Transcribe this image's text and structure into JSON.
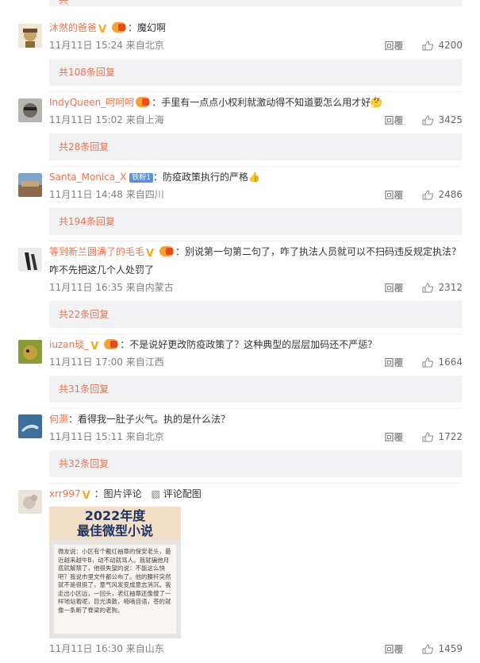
{
  "comments": [
    {
      "user": "沐然的爸爸",
      "text": "：魔幻啊",
      "time": "11月11日 15:24 来自北京",
      "reply": "回覆",
      "likes": "4200",
      "replies": "共108条回复",
      "avatar_color": "#c8a26b"
    },
    {
      "user": "IndyQueen_呵呵呵",
      "text": "：手里有一点点小权利就激动得不知道要怎么用才好",
      "time": "11月11日 15:02 来自上海",
      "reply": "回覆",
      "likes": "3425",
      "replies": "共28条回复",
      "avatar_color": "#6d6a66"
    },
    {
      "user": "Santa_Monica_X",
      "badge": "铁粉1",
      "text": "：防疫政策执行的严格",
      "time": "11月11日 14:48 来自四川",
      "reply": "回覆",
      "likes": "2486",
      "replies": "共194条回复",
      "avatar_color": "#8a6a4a"
    },
    {
      "user": "等到新兰圆满了的毛毛",
      "text": "：别说第一句第二句了，咋了执法人员就可以不扫码违反规定执法？",
      "text2": "咋不先把这几个人处罚了",
      "time": "11月11日 16:35 来自内蒙古",
      "reply": "回覆",
      "likes": "2312",
      "replies": "共22条回复",
      "avatar_color": "#d9d9d9"
    },
    {
      "user": "iuzan琰_",
      "text": "：不是说好更改防疫政策了？这种典型的层层加码还不严惩？",
      "time": "11月11日 17:00 来自江西",
      "reply": "回覆",
      "likes": "1664",
      "replies": "共31条回复",
      "avatar_color": "#7a8a3a"
    },
    {
      "user": "何灏",
      "text": "：看得我一肚子火气。执的是什么法？",
      "time": "11月11日 15:11 来自北京",
      "reply": "回覆",
      "likes": "1722",
      "replies": "共32条回复",
      "avatar_color": "#5a8bb0"
    },
    {
      "user": "xrr997",
      "text": "：图片评论",
      "pic_link": "评论配图",
      "time": "11月11日 16:30 来自山东",
      "reply": "回覆",
      "likes": "1459",
      "avatar_color": "#cfc6bb"
    }
  ],
  "top_replies_partial": "共",
  "image_comment": {
    "title_line1": "2022年度",
    "title_line2": "最佳微型小说",
    "body": "微友说：小区有个戴红袖章的保安老头，最近越来越牛B，动不动就骂人。我就骗他月底就解禁了，他很失望的说：不能这么快吧？我说市里文件都公布了。他的腰杆突然就不是很挺了，意气风发变成意志消沉。我走出小区远，一回头，老红袖章还像傻了一样地站着呢，目光涣散，喃喃自语，苍的就像一条断了脊梁的老狗。"
  },
  "colors": {
    "accent": "#eb7350",
    "reply_bg": "#f2f2f5"
  }
}
